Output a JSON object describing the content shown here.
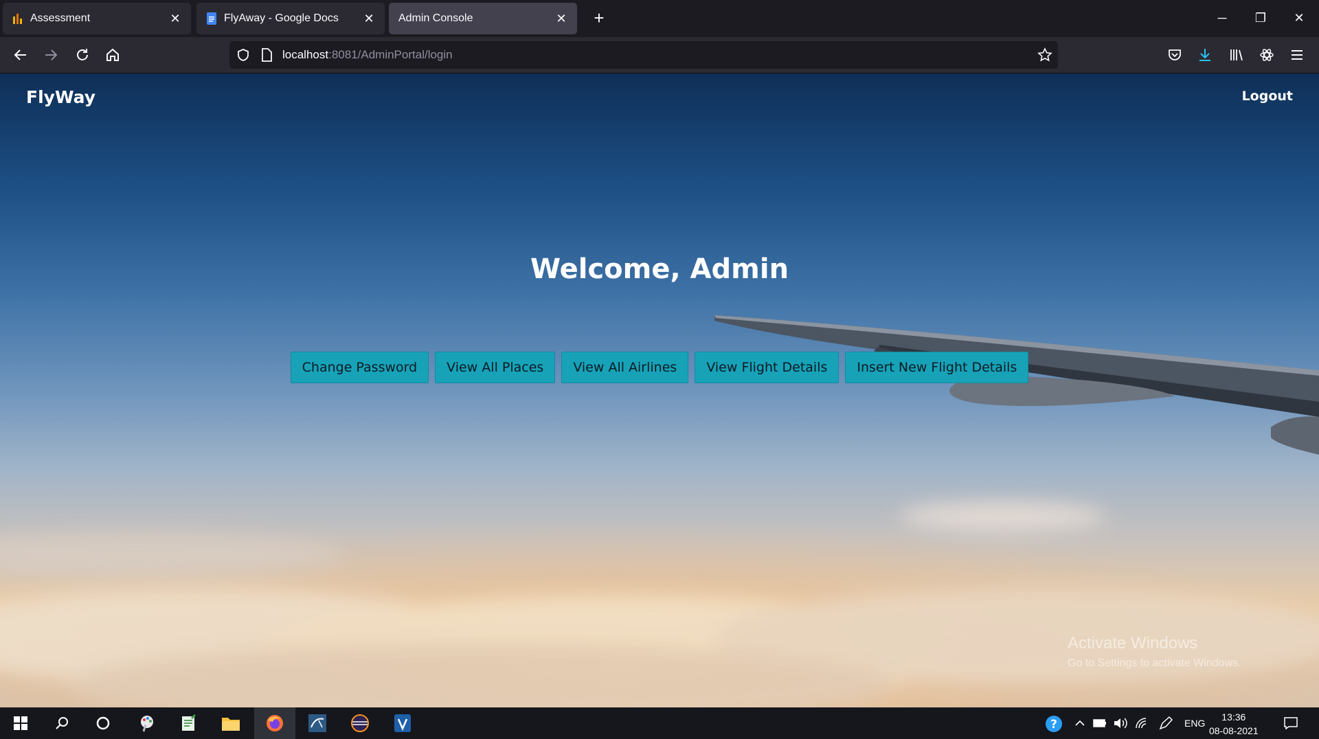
{
  "browser": {
    "tabs": [
      {
        "title": "Assessment",
        "icon": "analytics-icon",
        "active": false
      },
      {
        "title": "FlyAway - Google Docs",
        "icon": "google-docs-icon",
        "active": false
      },
      {
        "title": "Admin Console",
        "icon": "",
        "active": true
      }
    ],
    "url_host": "localhost",
    "url_rest": ":8081/AdminPortal/login"
  },
  "page": {
    "brand": "FlyWay",
    "logout": "Logout",
    "welcome": "Welcome, Admin",
    "buttons": [
      "Change Password",
      "View All Places",
      "View All Airlines",
      "View Flight Details",
      "Insert New Flight Details"
    ],
    "button_color": "#17a2b8",
    "watermark_title": "Activate Windows",
    "watermark_sub": "Go to Settings to activate Windows."
  },
  "taskbar": {
    "language": "ENG",
    "time": "13:36",
    "date": "08-08-2021"
  }
}
